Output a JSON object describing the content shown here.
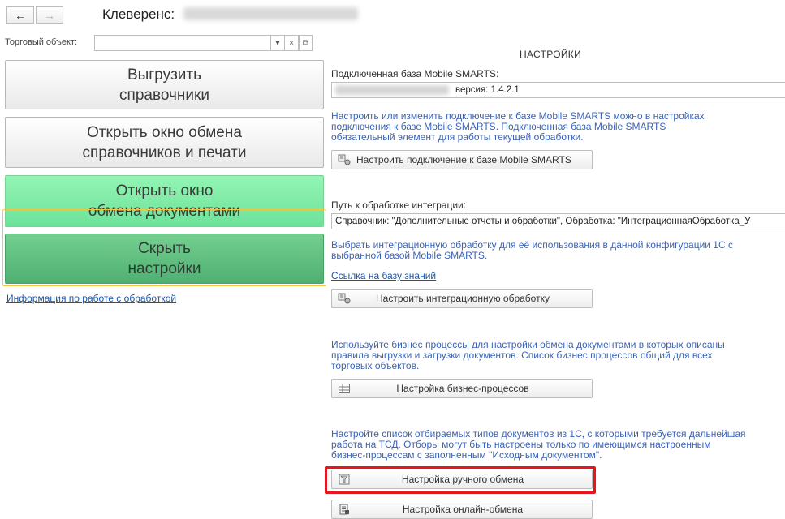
{
  "toolbar": {
    "back_glyph": "←",
    "forward_glyph": "→",
    "title": "Клеверенс:"
  },
  "trade_object": {
    "label": "Торговый объект:",
    "value": "",
    "dropdown_glyph": "▾",
    "clear_glyph": "×",
    "open_glyph": "⧉"
  },
  "main_buttons": {
    "upload": [
      "Выгрузить",
      "справочники"
    ],
    "open_exchange": [
      "Открыть окно обмена",
      "справочников и печати"
    ],
    "open_documents": [
      "Открыть окно",
      "обмена документами"
    ],
    "hide_settings": [
      "Скрыть",
      "настройки"
    ]
  },
  "info_link": "Информация по работе с обработкой",
  "settings": {
    "header": "НАСТРОЙКИ",
    "db_label": "Подключенная база Mobile SMARTS:",
    "db_version": "версия: 1.4.2.1",
    "db_hint": [
      "Настроить или изменить подключение к базе Mobile SMARTS можно в настройках",
      "подключения к базе Mobile SMARTS. Подключенная база Mobile SMARTS",
      "обязательный элемент для работы текущей обработки."
    ],
    "db_button": "Настроить подключение к базе Mobile SMARTS",
    "path_label": "Путь к обработке интеграции:",
    "path_value": "Справочник: \"Дополнительные отчеты и обработки\", Обработка: \"ИнтеграционнаяОбработка_У",
    "path_hint": [
      "Выбрать интеграционную обработку для её использования в данной конфигурации 1С с",
      "выбранной базой Mobile SMARTS."
    ],
    "kb_link": "Ссылка на базу знаний",
    "integration_button": "Настроить интеграционную обработку",
    "bp_hint": [
      "Используйте бизнес процессы для настройки обмена документами в которых описаны",
      "правила выгрузки и загрузки документов. Список бизнес процессов общий для всех",
      "торговых объектов."
    ],
    "bp_button": "Настройка бизнес-процессов",
    "manual_hint": [
      "Настройте список отбираемых типов документов из 1С, с которыми требуется дальнейшая",
      "работа на ТСД. Отборы могут быть настроены только по имеющимся настроенным",
      "бизнес-процессам с заполненным \"Исходным документом\"."
    ],
    "manual_button": "Настройка ручного обмена",
    "online_button": "Настройка онлайн-обмена"
  },
  "colors": {
    "link": "#1a55a8",
    "hint": "#3a63b8",
    "highlight": "#e8161c",
    "green": "#7fe6a4",
    "dark_green": "#5cbc7d"
  }
}
